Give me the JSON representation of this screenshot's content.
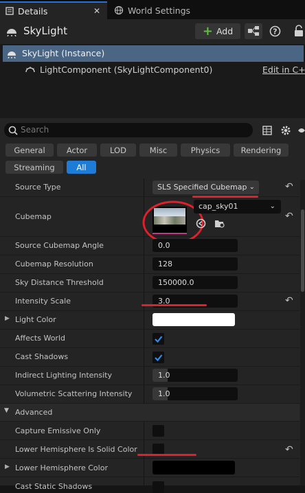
{
  "tabs": {
    "details": "Details",
    "world_settings": "World Settings"
  },
  "header": {
    "title": "SkyLight",
    "add_label": "Add"
  },
  "tree": {
    "instance": "SkyLight (Instance)",
    "component": "LightComponent (SkyLightComponent0)",
    "edit_link": "Edit in C++"
  },
  "search": {
    "placeholder": "Search"
  },
  "filters": [
    "General",
    "Actor",
    "LOD",
    "Misc",
    "Physics",
    "Rendering",
    "Streaming",
    "All"
  ],
  "properties": {
    "source_type": {
      "label": "Source Type",
      "value": "SLS Specified Cubemap"
    },
    "cubemap": {
      "label": "Cubemap",
      "asset": "cap_sky01"
    },
    "source_cubemap_angle": {
      "label": "Source Cubemap Angle",
      "value": "0.0"
    },
    "cubemap_resolution": {
      "label": "Cubemap Resolution",
      "value": "128"
    },
    "sky_distance_threshold": {
      "label": "Sky Distance Threshold",
      "value": "150000.0"
    },
    "intensity_scale": {
      "label": "Intensity Scale",
      "value": "3.0"
    },
    "light_color": {
      "label": "Light Color"
    },
    "affects_world": {
      "label": "Affects World"
    },
    "cast_shadows": {
      "label": "Cast Shadows"
    },
    "indirect_lighting_intensity": {
      "label": "Indirect Lighting Intensity",
      "value": "1.0"
    },
    "volumetric_scattering_intensity": {
      "label": "Volumetric Scattering Intensity",
      "value": "1.0"
    },
    "advanced": {
      "label": "Advanced"
    },
    "capture_emissive_only": {
      "label": "Capture Emissive Only"
    },
    "lower_hemisphere_solid": {
      "label": "Lower Hemisphere Is Solid Color"
    },
    "lower_hemisphere_color": {
      "label": "Lower Hemisphere Color"
    },
    "cast_static_shadows": {
      "label": "Cast Static Shadows"
    }
  },
  "colors": {
    "accent": "#1e7cd6",
    "selection": "#4b6685",
    "add_icon": "#5fbf3f",
    "annotation": "#e0202a"
  }
}
